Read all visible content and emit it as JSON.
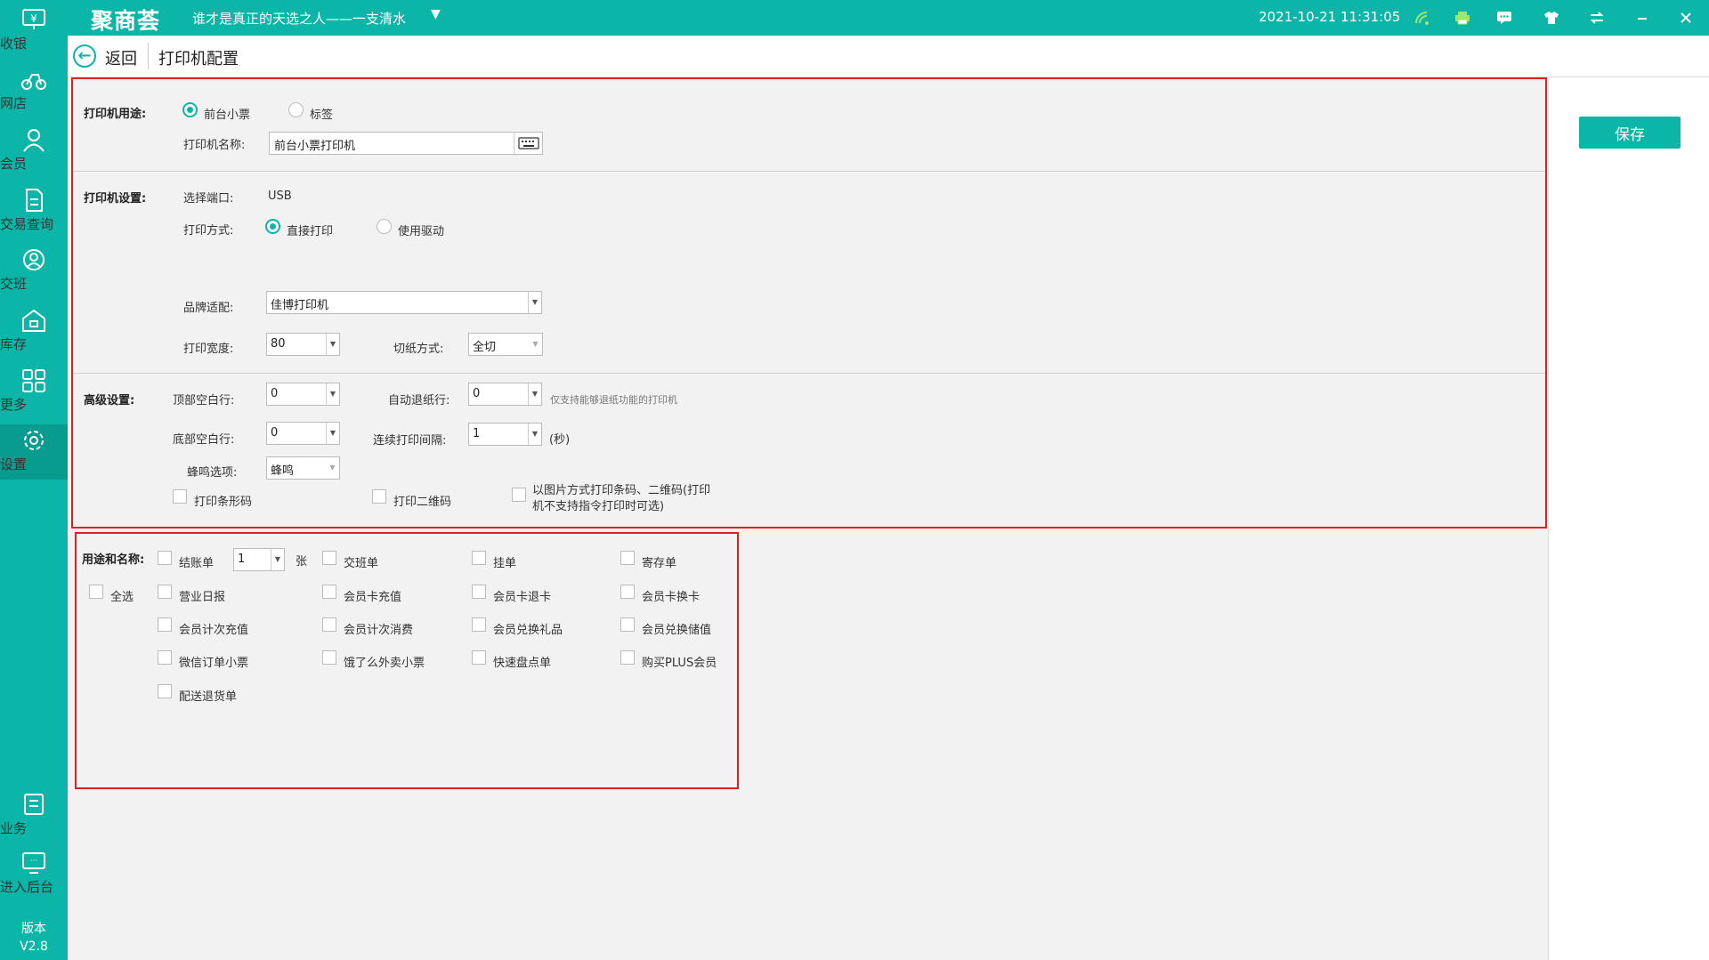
{
  "topbar": {
    "brand": "聚商荟",
    "store_name": "谁才是真正的天选之人——一支清水",
    "datetime": "2021-10-21 11:31:05"
  },
  "colors": {
    "accent": "#0bb5a7",
    "highlight": "#e0201e"
  },
  "sidebar": {
    "items": [
      {
        "label": "收银",
        "icon": "cashier-icon"
      },
      {
        "label": "网店",
        "icon": "online-shop-icon"
      },
      {
        "label": "会员",
        "icon": "member-icon"
      },
      {
        "label": "交易查询",
        "icon": "transaction-query-icon"
      },
      {
        "label": "交班",
        "icon": "shift-handover-icon"
      },
      {
        "label": "库存",
        "icon": "inventory-icon"
      },
      {
        "label": "更多",
        "icon": "more-icon"
      },
      {
        "label": "设置",
        "icon": "settings-icon",
        "active": true
      },
      {
        "label": "业务",
        "icon": "business-icon"
      },
      {
        "label": "进入后台",
        "icon": "backend-icon"
      }
    ],
    "version_label": "版本",
    "version": "V2.8"
  },
  "header": {
    "back_label": "返回",
    "title": "打印机配置"
  },
  "save_label": "保存",
  "usage": {
    "label": "打印机用途:",
    "options": [
      "前台小票",
      "标签"
    ],
    "selected": "前台小票",
    "name_label": "打印机名称:",
    "name_value": "前台小票打印机"
  },
  "settings": {
    "label": "打印机设置:",
    "port_label": "选择端口:",
    "port_value": "USB",
    "mode_label": "打印方式:",
    "mode_options": [
      "直接打印",
      "使用驱动"
    ],
    "mode_selected": "直接打印",
    "brand_label": "品牌适配:",
    "brand_value": "佳博打印机",
    "width_label": "打印宽度:",
    "width_value": "80",
    "cut_label": "切纸方式:",
    "cut_value": "全切"
  },
  "advanced": {
    "label": "高级设置:",
    "top_blank_label": "顶部空白行:",
    "top_blank_value": "0",
    "auto_feed_label": "自动退纸行:",
    "auto_feed_value": "0",
    "auto_feed_hint": "仅支持能够退纸功能的打印机",
    "bottom_blank_label": "底部空白行:",
    "bottom_blank_value": "0",
    "interval_label": "连续打印间隔:",
    "interval_value": "1",
    "interval_unit": "(秒)",
    "beep_label": "蜂鸣选项:",
    "beep_value": "蜂鸣",
    "print_barcode": "打印条形码",
    "print_qrcode": "打印二维码",
    "image_mode_line1": "以图片方式打印条码、二维码(打印",
    "image_mode_line2": "机不支持指令打印时可选)"
  },
  "usage_names": {
    "label": "用途和名称:",
    "select_all": "全选",
    "copies_value": "1",
    "copies_unit": "张",
    "items": [
      "结账单",
      "交班单",
      "挂单",
      "寄存单",
      "营业日报",
      "会员卡充值",
      "会员卡退卡",
      "会员卡换卡",
      "会员计次充值",
      "会员计次消费",
      "会员兑换礼品",
      "会员兑换储值",
      "微信订单小票",
      "饿了么外卖小票",
      "快速盘点单",
      "购买PLUS会员",
      "配送退货单"
    ]
  }
}
